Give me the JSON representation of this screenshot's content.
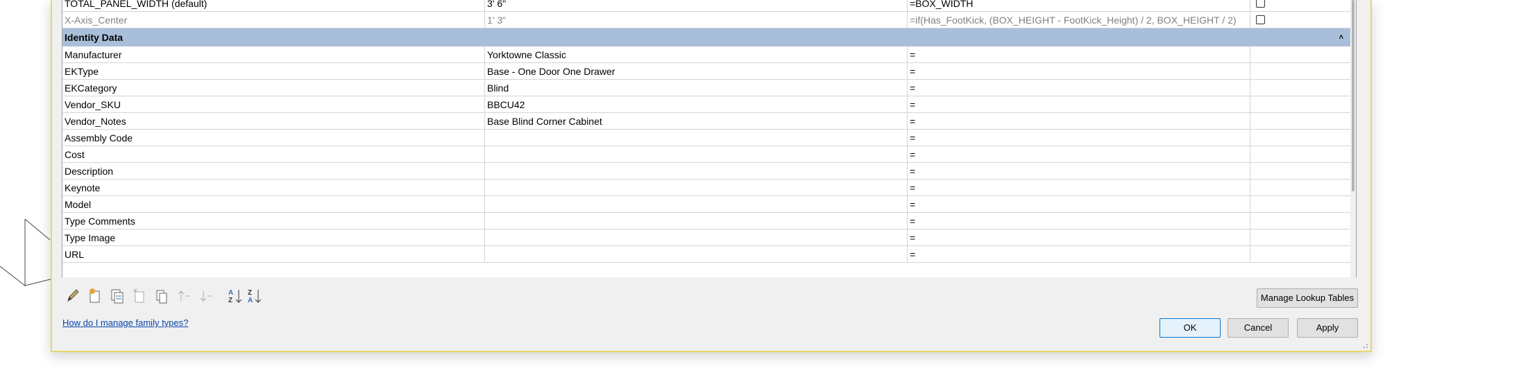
{
  "grid": {
    "top_rows": [
      {
        "name": "TOTAL_PANEL_WIDTH (default)",
        "value": "3'  6\"",
        "formula": "=BOX_WIDTH",
        "faded": false
      },
      {
        "name": "X-Axis_Center",
        "value": "1'  3\"",
        "formula": "=if(Has_FootKick, (BOX_HEIGHT - FootKick_Height) / 2, BOX_HEIGHT / 2)",
        "faded": true
      }
    ],
    "group": {
      "title": "Identity Data",
      "collapse_icon": "chevrons-up-icon"
    },
    "identity_rows": [
      {
        "name": "Manufacturer",
        "value": "Yorktowne Classic",
        "formula": "="
      },
      {
        "name": "EKType",
        "value": "Base - One Door One Drawer",
        "formula": "="
      },
      {
        "name": "EKCategory",
        "value": "Blind",
        "formula": "="
      },
      {
        "name": "Vendor_SKU",
        "value": "BBCU42",
        "formula": "="
      },
      {
        "name": "Vendor_Notes",
        "value": "Base Blind Corner Cabinet",
        "formula": "="
      },
      {
        "name": "Assembly Code",
        "value": "",
        "formula": "="
      },
      {
        "name": "Cost",
        "value": "",
        "formula": "="
      },
      {
        "name": "Description",
        "value": "",
        "formula": "="
      },
      {
        "name": "Keynote",
        "value": "",
        "formula": "="
      },
      {
        "name": "Model",
        "value": "",
        "formula": "="
      },
      {
        "name": "Type Comments",
        "value": "",
        "formula": "="
      },
      {
        "name": "Type Image",
        "value": "",
        "formula": "="
      },
      {
        "name": "URL",
        "value": "",
        "formula": "="
      }
    ]
  },
  "toolbar": {
    "icons": [
      "edit-parameter-icon",
      "new-parameter-icon",
      "copy-parameter-icon",
      "delete-parameter-icon",
      "shared-parameter-icon",
      "move-up-icon",
      "move-down-icon",
      "sort-ascending-icon",
      "sort-descending-icon"
    ]
  },
  "footer": {
    "help_link": "How do I manage family types?",
    "manage_lookup_label": "Manage Lookup Tables",
    "ok_label": "OK",
    "cancel_label": "Cancel",
    "apply_label": "Apply"
  },
  "colors": {
    "group_header": "#a9bfd9",
    "dialog_border": "#e8d66a",
    "link": "#0645ad"
  }
}
